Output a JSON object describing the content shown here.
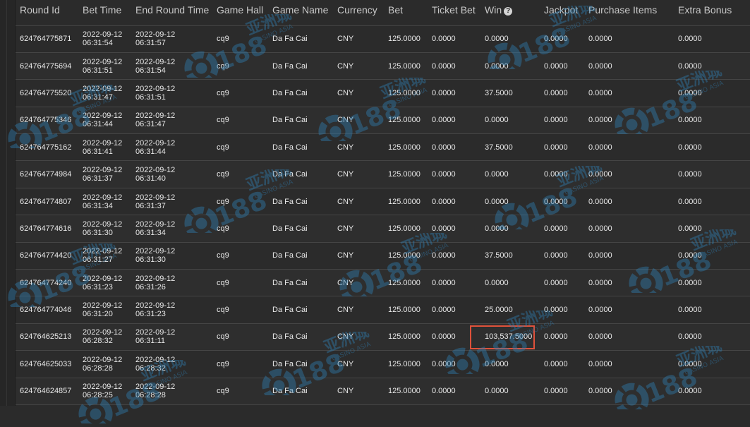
{
  "table": {
    "columns": {
      "round_id": "Round Id",
      "bet_time": "Bet Time",
      "end_round_time": "End Round Time",
      "game_hall": "Game Hall",
      "game_name": "Game Name",
      "currency": "Currency",
      "bet": "Bet",
      "ticket_bet": "Ticket Bet",
      "win": "Win",
      "jackpot": "Jackpot",
      "purchase_items": "Purchase Items",
      "extra_bonus": "Extra Bonus"
    },
    "rows": [
      {
        "round_id": "624764775871",
        "bet_date": "2022-09-12",
        "bet_clock": "06:31:54",
        "end_date": "2022-09-12",
        "end_clock": "06:31:57",
        "game_hall": "cq9",
        "game_name": "Da Fa Cai",
        "currency": "CNY",
        "bet": "125.0000",
        "ticket_bet": "0.0000",
        "win": "0.0000",
        "jackpot": "0.0000",
        "purchase_items": "0.0000",
        "extra_bonus": "0.0000"
      },
      {
        "round_id": "624764775694",
        "bet_date": "2022-09-12",
        "bet_clock": "06:31:51",
        "end_date": "2022-09-12",
        "end_clock": "06:31:54",
        "game_hall": "cq9",
        "game_name": "Da Fa Cai",
        "currency": "CNY",
        "bet": "125.0000",
        "ticket_bet": "0.0000",
        "win": "0.0000",
        "jackpot": "0.0000",
        "purchase_items": "0.0000",
        "extra_bonus": "0.0000"
      },
      {
        "round_id": "624764775520",
        "bet_date": "2022-09-12",
        "bet_clock": "06:31:47",
        "end_date": "2022-09-12",
        "end_clock": "06:31:51",
        "game_hall": "cq9",
        "game_name": "Da Fa Cai",
        "currency": "CNY",
        "bet": "125.0000",
        "ticket_bet": "0.0000",
        "win": "37.5000",
        "jackpot": "0.0000",
        "purchase_items": "0.0000",
        "extra_bonus": "0.0000"
      },
      {
        "round_id": "624764775346",
        "bet_date": "2022-09-12",
        "bet_clock": "06:31:44",
        "end_date": "2022-09-12",
        "end_clock": "06:31:47",
        "game_hall": "cq9",
        "game_name": "Da Fa Cai",
        "currency": "CNY",
        "bet": "125.0000",
        "ticket_bet": "0.0000",
        "win": "0.0000",
        "jackpot": "0.0000",
        "purchase_items": "0.0000",
        "extra_bonus": "0.0000"
      },
      {
        "round_id": "624764775162",
        "bet_date": "2022-09-12",
        "bet_clock": "06:31:41",
        "end_date": "2022-09-12",
        "end_clock": "06:31:44",
        "game_hall": "cq9",
        "game_name": "Da Fa Cai",
        "currency": "CNY",
        "bet": "125.0000",
        "ticket_bet": "0.0000",
        "win": "37.5000",
        "jackpot": "0.0000",
        "purchase_items": "0.0000",
        "extra_bonus": "0.0000"
      },
      {
        "round_id": "624764774984",
        "bet_date": "2022-09-12",
        "bet_clock": "06:31:37",
        "end_date": "2022-09-12",
        "end_clock": "06:31:40",
        "game_hall": "cq9",
        "game_name": "Da Fa Cai",
        "currency": "CNY",
        "bet": "125.0000",
        "ticket_bet": "0.0000",
        "win": "0.0000",
        "jackpot": "0.0000",
        "purchase_items": "0.0000",
        "extra_bonus": "0.0000"
      },
      {
        "round_id": "624764774807",
        "bet_date": "2022-09-12",
        "bet_clock": "06:31:34",
        "end_date": "2022-09-12",
        "end_clock": "06:31:37",
        "game_hall": "cq9",
        "game_name": "Da Fa Cai",
        "currency": "CNY",
        "bet": "125.0000",
        "ticket_bet": "0.0000",
        "win": "0.0000",
        "jackpot": "0.0000",
        "purchase_items": "0.0000",
        "extra_bonus": "0.0000"
      },
      {
        "round_id": "624764774616",
        "bet_date": "2022-09-12",
        "bet_clock": "06:31:30",
        "end_date": "2022-09-12",
        "end_clock": "06:31:34",
        "game_hall": "cq9",
        "game_name": "Da Fa Cai",
        "currency": "CNY",
        "bet": "125.0000",
        "ticket_bet": "0.0000",
        "win": "0.0000",
        "jackpot": "0.0000",
        "purchase_items": "0.0000",
        "extra_bonus": "0.0000"
      },
      {
        "round_id": "624764774420",
        "bet_date": "2022-09-12",
        "bet_clock": "06:31:27",
        "end_date": "2022-09-12",
        "end_clock": "06:31:30",
        "game_hall": "cq9",
        "game_name": "Da Fa Cai",
        "currency": "CNY",
        "bet": "125.0000",
        "ticket_bet": "0.0000",
        "win": "37.5000",
        "jackpot": "0.0000",
        "purchase_items": "0.0000",
        "extra_bonus": "0.0000"
      },
      {
        "round_id": "624764774240",
        "bet_date": "2022-09-12",
        "bet_clock": "06:31:23",
        "end_date": "2022-09-12",
        "end_clock": "06:31:26",
        "game_hall": "cq9",
        "game_name": "Da Fa Cai",
        "currency": "CNY",
        "bet": "125.0000",
        "ticket_bet": "0.0000",
        "win": "0.0000",
        "jackpot": "0.0000",
        "purchase_items": "0.0000",
        "extra_bonus": "0.0000"
      },
      {
        "round_id": "624764774046",
        "bet_date": "2022-09-12",
        "bet_clock": "06:31:20",
        "end_date": "2022-09-12",
        "end_clock": "06:31:23",
        "game_hall": "cq9",
        "game_name": "Da Fa Cai",
        "currency": "CNY",
        "bet": "125.0000",
        "ticket_bet": "0.0000",
        "win": "25.0000",
        "jackpot": "0.0000",
        "purchase_items": "0.0000",
        "extra_bonus": "0.0000"
      },
      {
        "round_id": "624764625213",
        "bet_date": "2022-09-12",
        "bet_clock": "06:28:32",
        "end_date": "2022-09-12",
        "end_clock": "06:31:11",
        "game_hall": "cq9",
        "game_name": "Da Fa Cai",
        "currency": "CNY",
        "bet": "125.0000",
        "ticket_bet": "0.0000",
        "win": "103,537.5000",
        "jackpot": "0.0000",
        "purchase_items": "0.0000",
        "extra_bonus": "0.0000",
        "highlighted": true
      },
      {
        "round_id": "624764625033",
        "bet_date": "2022-09-12",
        "bet_clock": "06:28:28",
        "end_date": "2022-09-12",
        "end_clock": "06:28:32",
        "game_hall": "cq9",
        "game_name": "Da Fa Cai",
        "currency": "CNY",
        "bet": "125.0000",
        "ticket_bet": "0.0000",
        "win": "0.0000",
        "jackpot": "0.0000",
        "purchase_items": "0.0000",
        "extra_bonus": "0.0000"
      },
      {
        "round_id": "624764624857",
        "bet_date": "2022-09-12",
        "bet_clock": "06:28:25",
        "end_date": "2022-09-12",
        "end_clock": "06:28:28",
        "game_hall": "cq9",
        "game_name": "Da Fa Cai",
        "currency": "CNY",
        "bet": "125.0000",
        "ticket_bet": "0.0000",
        "win": "0.0000",
        "jackpot": "0.0000",
        "purchase_items": "0.0000",
        "extra_bonus": "0.0000"
      }
    ]
  },
  "win_help_icon": "question-circle-icon",
  "highlight_color": "#e0513a",
  "watermark": {
    "brand": "CQ188",
    "cn_text": "亚洲城",
    "en_text": "CASINO ASIA",
    "color": "#2f7fb3"
  }
}
